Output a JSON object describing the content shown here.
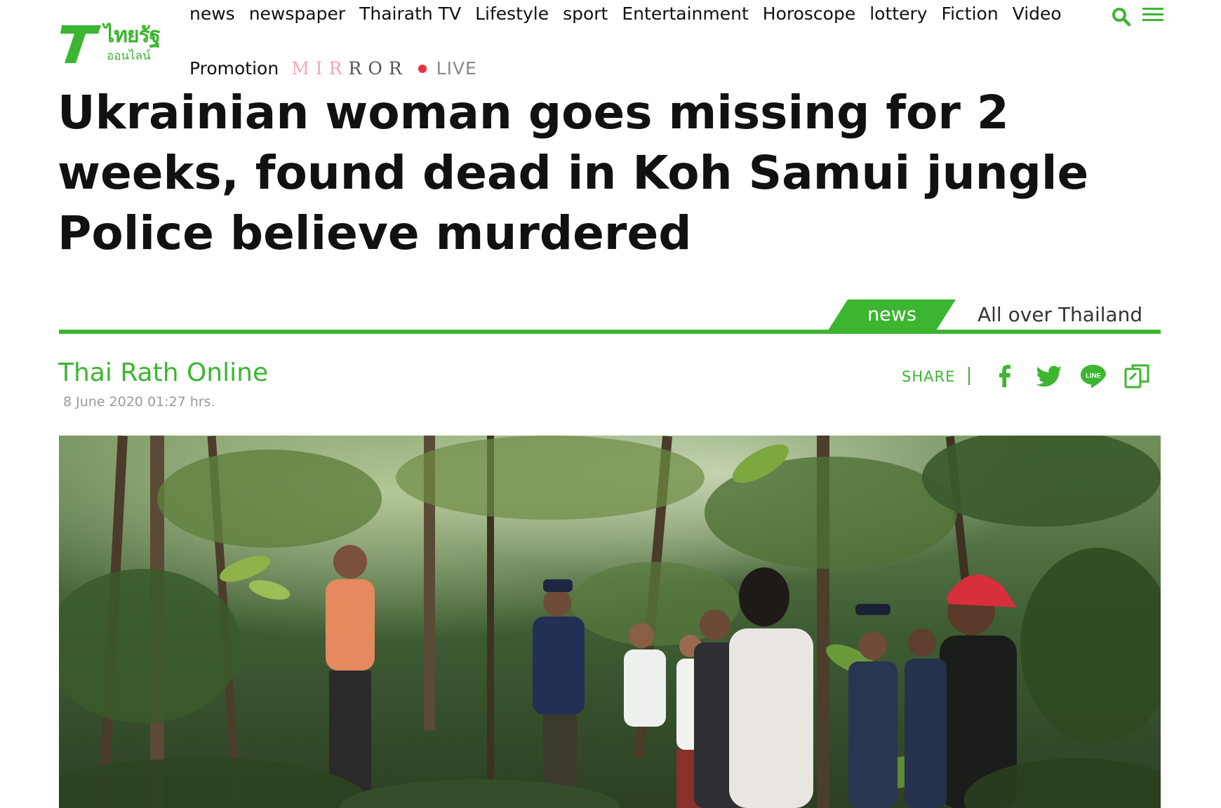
{
  "brand": {
    "logo_thai_top": "ไทยรัฐ",
    "logo_thai_bottom": "ออนไลน์",
    "accent_color": "#3cb531"
  },
  "nav": {
    "primary": [
      "news",
      "newspaper",
      "Thairath TV",
      "Lifestyle",
      "sport",
      "Entertainment",
      "Horoscope",
      "lottery",
      "Fiction",
      "Video"
    ],
    "promotion": "Promotion",
    "mirror_pink": "MIR",
    "mirror_grey": "ROR",
    "live": "LIVE",
    "icons": [
      "search-icon",
      "menu-icon"
    ]
  },
  "article": {
    "headline": "Ukrainian woman goes missing for 2 weeks, found dead in Koh Samui jungle Police believe murdered",
    "category": "news",
    "subcategory": "All over Thailand",
    "author": "Thai Rath Online",
    "date": "8 June 2020 01:27 hrs."
  },
  "share": {
    "label": "SHARE",
    "separator": "|",
    "line_label": "LINE",
    "icons": [
      "facebook-icon",
      "twitter-icon",
      "line-icon",
      "copy-link-icon"
    ]
  }
}
